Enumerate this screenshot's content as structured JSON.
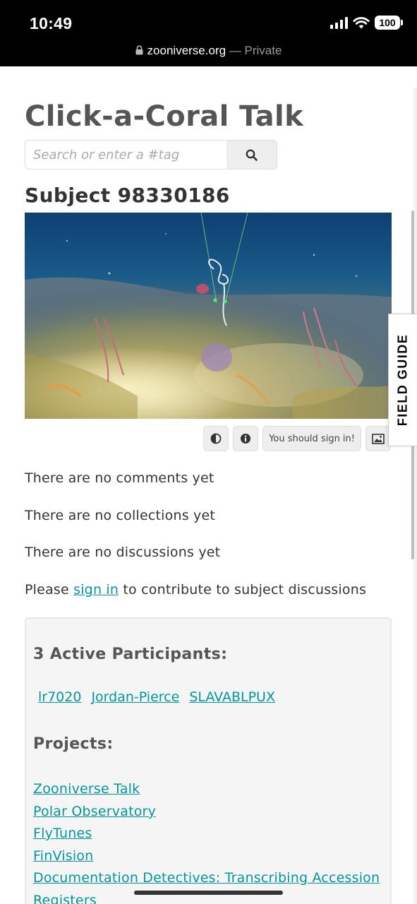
{
  "status_bar": {
    "time": "10:49",
    "battery": "100",
    "url": "zooniverse.org",
    "url_suffix": "— Private"
  },
  "header": {
    "title": "Click-a-Coral Talk",
    "search_placeholder": "Search or enter a #tag",
    "search_icon": "magnifier-icon"
  },
  "subject": {
    "title": "Subject 98330186",
    "image_alt": "Underwater seafloor photo with corals",
    "tools": {
      "invert_icon": "contrast-icon",
      "info_icon": "info-icon",
      "sign_in_label": "You should sign in!",
      "image_icon": "image-icon"
    }
  },
  "field_guide_label": "FIELD GUIDE",
  "messages": {
    "comments": "There are no comments yet",
    "collections": "There are no collections yet",
    "discussions": "There are no discussions yet",
    "please": "Please",
    "sign_in": "sign in",
    "contribute": "to contribute to subject discussions"
  },
  "participants": {
    "heading": "3 Active Participants:",
    "users": [
      "lr7020",
      "Jordan-Pierce",
      "SLAVABLPUX"
    ]
  },
  "projects": {
    "heading": "Projects:",
    "items": [
      "Zooniverse Talk",
      "Polar Observatory",
      "FlyTunes",
      "FinVision",
      "Documentation Detectives: Transcribing Accession",
      "Registers"
    ]
  },
  "colors": {
    "link": "#00979d",
    "heading_gray": "#555555",
    "panel_bg": "#f5f5f5"
  }
}
